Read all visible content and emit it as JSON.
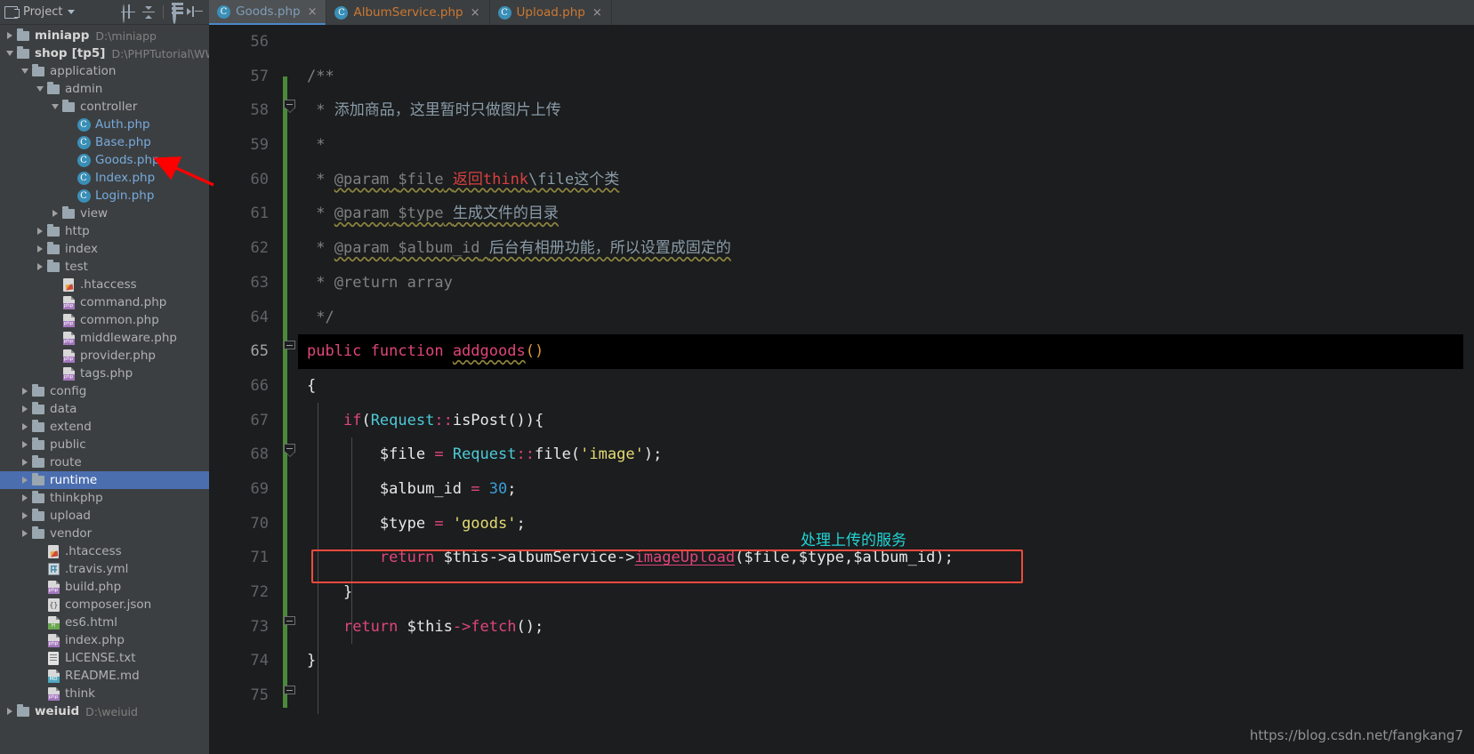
{
  "sidebar": {
    "title": "Project",
    "toolbar_icons": [
      "locate-icon",
      "collapse-all-icon",
      "settings-icon",
      "hide-icon"
    ],
    "tree": [
      {
        "depth": 0,
        "twisty": "closed",
        "icon": "folder-icon",
        "label": "miniapp",
        "bold": true,
        "path": "D:\\miniapp"
      },
      {
        "depth": 0,
        "twisty": "open",
        "icon": "folder-icon",
        "label": "shop",
        "module": "[tp5]",
        "bold": true,
        "path": "D:\\PHPTutorial\\WWW\\s"
      },
      {
        "depth": 1,
        "twisty": "open",
        "icon": "folder-icon",
        "label": "application"
      },
      {
        "depth": 2,
        "twisty": "open",
        "icon": "folder-icon",
        "label": "admin"
      },
      {
        "depth": 3,
        "twisty": "open",
        "icon": "folder-icon",
        "label": "controller"
      },
      {
        "depth": 4,
        "twisty": "none",
        "icon": "php-class-icon",
        "label": "Auth.php",
        "color": "blue"
      },
      {
        "depth": 4,
        "twisty": "none",
        "icon": "php-class-icon",
        "label": "Base.php",
        "color": "blue"
      },
      {
        "depth": 4,
        "twisty": "none",
        "icon": "php-class-icon",
        "label": "Goods.php",
        "color": "blue"
      },
      {
        "depth": 4,
        "twisty": "none",
        "icon": "php-class-icon",
        "label": "Index.php",
        "color": "blue"
      },
      {
        "depth": 4,
        "twisty": "none",
        "icon": "php-class-icon",
        "label": "Login.php",
        "color": "blue"
      },
      {
        "depth": 3,
        "twisty": "closed",
        "icon": "folder-icon",
        "label": "view"
      },
      {
        "depth": 2,
        "twisty": "closed",
        "icon": "folder-icon",
        "label": "http"
      },
      {
        "depth": 2,
        "twisty": "closed",
        "icon": "folder-icon",
        "label": "index"
      },
      {
        "depth": 2,
        "twisty": "closed",
        "icon": "folder-icon",
        "label": "test"
      },
      {
        "depth": 3,
        "twisty": "none",
        "icon": "htaccess-icon",
        "label": ".htaccess"
      },
      {
        "depth": 3,
        "twisty": "none",
        "icon": "php-file-icon",
        "label": "command.php"
      },
      {
        "depth": 3,
        "twisty": "none",
        "icon": "php-file-icon",
        "label": "common.php"
      },
      {
        "depth": 3,
        "twisty": "none",
        "icon": "php-file-icon",
        "label": "middleware.php"
      },
      {
        "depth": 3,
        "twisty": "none",
        "icon": "php-file-icon",
        "label": "provider.php"
      },
      {
        "depth": 3,
        "twisty": "none",
        "icon": "php-file-icon",
        "label": "tags.php"
      },
      {
        "depth": 1,
        "twisty": "closed",
        "icon": "folder-icon",
        "label": "config"
      },
      {
        "depth": 1,
        "twisty": "closed",
        "icon": "folder-icon",
        "label": "data"
      },
      {
        "depth": 1,
        "twisty": "closed",
        "icon": "folder-icon",
        "label": "extend"
      },
      {
        "depth": 1,
        "twisty": "closed",
        "icon": "folder-icon",
        "label": "public"
      },
      {
        "depth": 1,
        "twisty": "closed",
        "icon": "folder-icon",
        "label": "route"
      },
      {
        "depth": 1,
        "twisty": "closed",
        "icon": "folder-icon",
        "label": "runtime",
        "selected": true
      },
      {
        "depth": 1,
        "twisty": "closed",
        "icon": "folder-icon",
        "label": "thinkphp"
      },
      {
        "depth": 1,
        "twisty": "closed",
        "icon": "folder-icon",
        "label": "upload"
      },
      {
        "depth": 1,
        "twisty": "closed",
        "icon": "folder-icon",
        "label": "vendor"
      },
      {
        "depth": 2,
        "twisty": "none",
        "icon": "htaccess-icon",
        "label": ".htaccess"
      },
      {
        "depth": 2,
        "twisty": "none",
        "icon": "yaml-icon",
        "label": ".travis.yml"
      },
      {
        "depth": 2,
        "twisty": "none",
        "icon": "php-file-icon",
        "label": "build.php"
      },
      {
        "depth": 2,
        "twisty": "none",
        "icon": "json-icon",
        "label": "composer.json"
      },
      {
        "depth": 2,
        "twisty": "none",
        "icon": "html-file-icon",
        "label": "es6.html"
      },
      {
        "depth": 2,
        "twisty": "none",
        "icon": "php-file-icon",
        "label": "index.php"
      },
      {
        "depth": 2,
        "twisty": "none",
        "icon": "text-file-icon",
        "label": "LICENSE.txt"
      },
      {
        "depth": 2,
        "twisty": "none",
        "icon": "markdown-icon",
        "label": "README.md"
      },
      {
        "depth": 2,
        "twisty": "none",
        "icon": "php-file-icon",
        "label": "think"
      },
      {
        "depth": 0,
        "twisty": "closed",
        "icon": "folder-icon",
        "label": "weiuid",
        "bold": true,
        "path": "D:\\weiuid"
      }
    ]
  },
  "tabs": [
    {
      "label": "Goods.php",
      "icon": "php-class-icon",
      "active": true,
      "close": "×"
    },
    {
      "label": "AlbumService.php",
      "icon": "php-class-icon",
      "active": false,
      "close": "×"
    },
    {
      "label": "Upload.php",
      "icon": "php-class-icon",
      "active": false,
      "close": "×"
    }
  ],
  "editor": {
    "line_numbers": [
      "56",
      "57",
      "58",
      "59",
      "60",
      "61",
      "62",
      "63",
      "64",
      "65",
      "66",
      "67",
      "68",
      "69",
      "70",
      "71",
      "72",
      "73",
      "74",
      "75"
    ],
    "current_line": "65",
    "lines": [
      {
        "num": "56",
        "text": ""
      },
      {
        "num": "57",
        "text": "    /**"
      },
      {
        "num": "58",
        "text": "     * 添加商品，这里暂时只做图片上传"
      },
      {
        "num": "59",
        "text": "     *"
      },
      {
        "num": "60",
        "text": "     * @param $file 返回think\\file这个类"
      },
      {
        "num": "61",
        "text": "     * @param $type 生成文件的目录"
      },
      {
        "num": "62",
        "text": "     * @param $album_id 后台有相册功能，所以设置成固定的"
      },
      {
        "num": "63",
        "text": "     * @return array"
      },
      {
        "num": "64",
        "text": "     */"
      },
      {
        "num": "65",
        "text": "    public function addgoods()"
      },
      {
        "num": "66",
        "text": "    {"
      },
      {
        "num": "67",
        "text": "        if(Request::isPost()){"
      },
      {
        "num": "68",
        "text": "            $file = Request::file('image');"
      },
      {
        "num": "69",
        "text": "            $album_id = 30;"
      },
      {
        "num": "70",
        "text": "            $type = 'goods';"
      },
      {
        "num": "71",
        "text": "            return $this->albumService->imageUpload($file,$type,$album_id);"
      },
      {
        "num": "72",
        "text": "        }"
      },
      {
        "num": "73",
        "text": "        return $this->fetch();"
      },
      {
        "num": "74",
        "text": "    }"
      },
      {
        "num": "75",
        "text": ""
      }
    ],
    "tokens": {
      "comment_open": "/**",
      "comment_star": "*",
      "cn_desc": "添加商品，这里暂时只做图片上传",
      "param": "@param",
      "var_file": "$file",
      "cn_file_red": "返回think",
      "cn_file_rest": "\\file这个类",
      "var_type": "$type",
      "cn_type": "生成文件的目录",
      "var_album": "$album_id",
      "cn_album": "后台有相册功能，所以设置成固定的",
      "return_tag": "@return array",
      "comment_close": "*/",
      "kw_public": "public",
      "kw_function": "function",
      "fn_addgoods": "addgoods",
      "brace_open": "{",
      "brace_close": "}",
      "kw_if": "if",
      "cls_request": "Request",
      "scope": "::",
      "mth_isPost": "isPost",
      "mth_file": "file",
      "str_image": "'image'",
      "num_30": "30",
      "str_goods": "'goods'",
      "kw_return": "return",
      "var_this": "$this",
      "arrow": "->",
      "prop_albumService": "albumService",
      "mth_imageUpload": "imageUpload",
      "args": "$file,$type,$album_id",
      "mth_fetch": "fetch"
    }
  },
  "annotations": {
    "callout_text": "处理上传的服务",
    "callout_color": "#24d4d4",
    "highlight_box_color": "#f04a3f",
    "arrow_color": "#ff0000",
    "arrow_target": "Goods.php"
  },
  "watermark": "https://blog.csdn.net/fangkang7"
}
